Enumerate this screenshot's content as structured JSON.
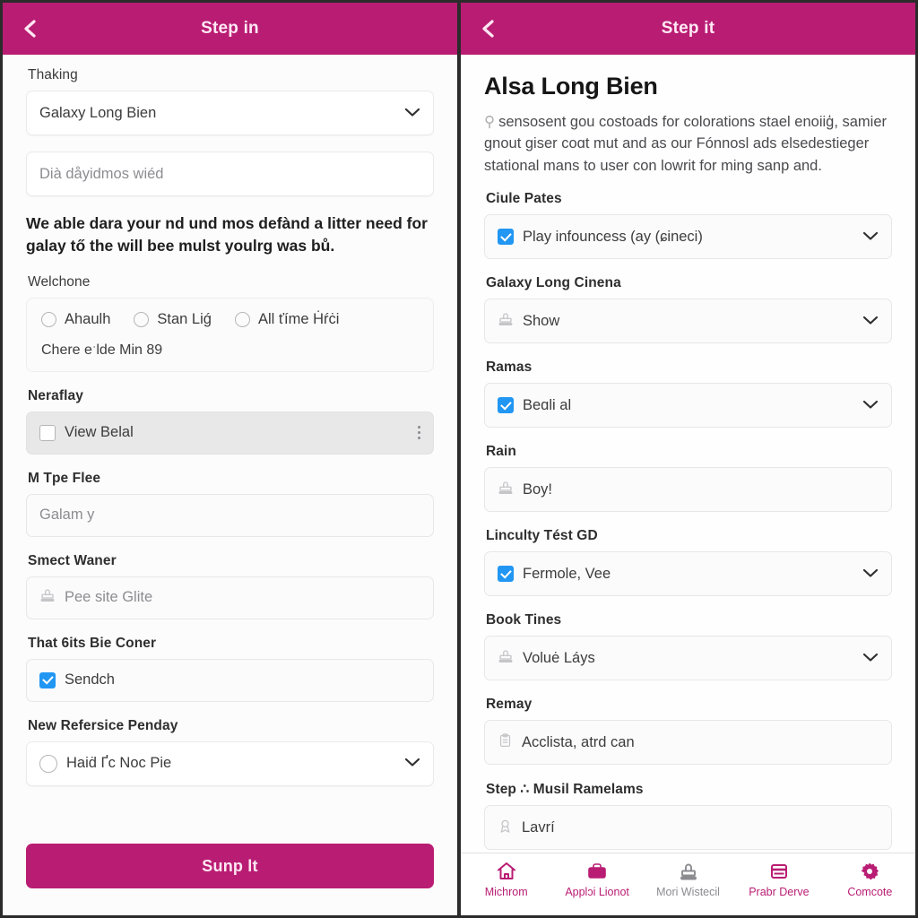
{
  "theme": {
    "accent": "#b91d73",
    "accent_text": "#ffe9f4",
    "checkbox_blue": "#2196f3",
    "muted_text": "#8b8b90"
  },
  "left_screen": {
    "appbar": {
      "title": "Step in",
      "back_icon": "chevron-left-icon"
    },
    "fields": [
      {
        "label": "Thaking",
        "type": "select",
        "value": "Galaxy Long Bien",
        "style": "white"
      },
      {
        "label": "",
        "type": "text",
        "value": "Dià dåyidmos wiéd",
        "placeholder": "Dià dåyidmos wiéd",
        "style": "white"
      }
    ],
    "paragraph": "We able dara your nd und mos defànd a litter need for galay tő the will bee mulst youlrg was bů.",
    "radio_group": {
      "label": "Welchone",
      "options": [
        "Ahaulh",
        "Stan Liǵ",
        "All ťíme Ḣŕċi"
      ],
      "hint": "Chere eˑlde Min 89"
    },
    "list_section": {
      "label": "Neraflay",
      "item_label": "View Belal",
      "checked": false,
      "overflow_icon": "kebab-menu-icon"
    },
    "text_field": {
      "label": "M Tpe Flee",
      "value": "Galam y"
    },
    "icon_field": {
      "label": "Smect Waner",
      "value": "Pee site Glite",
      "icon": "stamp-icon"
    },
    "check_field": {
      "label": "That 6its Bie Coner",
      "value": "Sendch",
      "checked": true
    },
    "radio_select": {
      "label": "New Refersice Penday",
      "value": "Haiḋ Ґc Noc Pie",
      "chevron_icon": "chevron-down-icon"
    },
    "submit_label": "Sunp lt"
  },
  "right_screen": {
    "appbar": {
      "title": "Step it",
      "back_icon": "chevron-left-icon"
    },
    "page_title": "Alsa Long Bien",
    "lede": "sensosent gou costoads for colorations stael enoiiģ, samier gnout giser coɑt mut and as our Fónnosl ads elsedestieger stational mans to user con lowrit for ming sanp and.",
    "fields": [
      {
        "label": "Ciule Pates",
        "value": "Play infouncess (ay (ɕineci)",
        "control": "checkbox-select",
        "checked": true,
        "chevron": true
      },
      {
        "label": "Galaxy Long Cinena",
        "value": "Show",
        "control": "icon-select",
        "icon": "stamp-icon",
        "chevron": true
      },
      {
        "label": "Ramas",
        "value": "Beɑli al",
        "control": "checkbox-select",
        "checked": true,
        "chevron": true
      },
      {
        "label": "Rain",
        "value": "Boy!",
        "control": "icon-field",
        "icon": "stamp-icon",
        "chevron": false
      },
      {
        "label": "Linculty Tést GD",
        "value": "Fermole, Vee",
        "control": "checkbox-select",
        "checked": true,
        "chevron": true
      },
      {
        "label": "Book Tines",
        "value": "Voluė Láys",
        "control": "icon-select",
        "icon": "stamp-icon",
        "chevron": true
      },
      {
        "label": "Remay",
        "value": "Acclista, atrd can",
        "control": "icon-field",
        "icon": "clipboard-icon",
        "chevron": false
      },
      {
        "label": "Step ∴ Musil Ramelams",
        "value": "Lavrí",
        "control": "icon-field",
        "icon": "badge-icon",
        "chevron": false
      }
    ],
    "tabbar": [
      {
        "label": "Michrom",
        "icon": "home-icon",
        "active": true
      },
      {
        "label": "Applɔi Lionot",
        "icon": "briefcase-icon",
        "active": true
      },
      {
        "label": "Mori Wistecil",
        "icon": "stamp-icon",
        "active": false
      },
      {
        "label": "Prabr Derve",
        "icon": "card-list-icon",
        "active": true
      },
      {
        "label": "Comcote",
        "icon": "gear-icon",
        "active": true
      }
    ]
  }
}
